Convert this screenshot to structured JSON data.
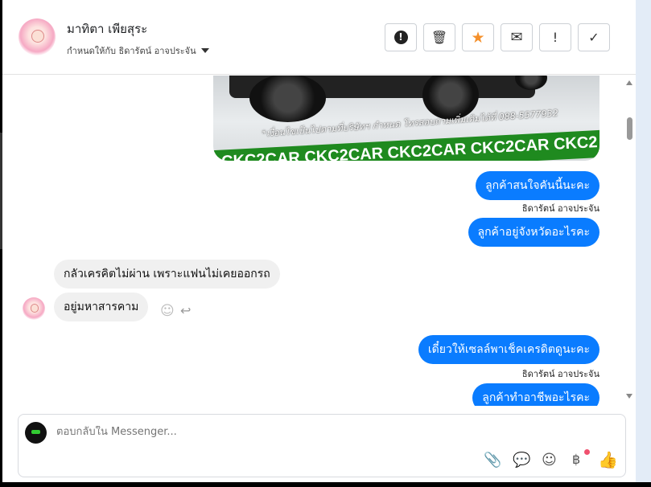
{
  "header": {
    "contact_name": "มาทิตา เพียสุระ",
    "assigned_to": "กำหนดให้กับ ธิดารัตน์ อาจประจัน",
    "actions": [
      {
        "name": "alert",
        "icon": "exclamation-circle-icon"
      },
      {
        "name": "delete",
        "icon": "trash-icon"
      },
      {
        "name": "star",
        "icon": "star-icon",
        "color": "#f5902b"
      },
      {
        "name": "mark-unread",
        "icon": "envelope-icon"
      },
      {
        "name": "important",
        "icon": "exclamation-icon"
      },
      {
        "name": "done",
        "icon": "check-icon"
      }
    ]
  },
  "photo": {
    "condition_text": "*เงื่อนไขเป็นไปตามที่บริษัทฯ กำหนด โทรสอบถามเพิ่มเติมได้ที่ 088-5577932",
    "banner_text": "CKC2CAR CKC2CAR CKC2CAR CKC2CAR CKC2"
  },
  "messages": [
    {
      "dir": "out",
      "text": "ลูกค้าสนใจคันนี้นะคะ",
      "sender": "ธิดารัตน์ อาจประจัน"
    },
    {
      "dir": "out",
      "text": "ลูกค้าอยู่จังหวัดอะไรคะ"
    },
    {
      "dir": "in",
      "text": "กลัวเครคิตไม่ผ่าน  เพราะแฟนไม่เคยออกรถ"
    },
    {
      "dir": "in",
      "text": "อยู่มหาสารคาม"
    },
    {
      "dir": "out",
      "text": "เดี๋ยวให้เซลล์พาเช็คเครดิตดูนะคะ",
      "sender": "ธิดารัตน์ อาจประจัน"
    },
    {
      "dir": "out",
      "text": "ลูกค้าทำอาชีพอะไรคะ"
    }
  ],
  "compose": {
    "placeholder": "ตอบกลับใน Messenger...",
    "currency_symbol": "฿"
  },
  "colors": {
    "accent": "#0a7cff",
    "incoming": "#f0f0f0",
    "notification_dot": "#f0506e"
  }
}
